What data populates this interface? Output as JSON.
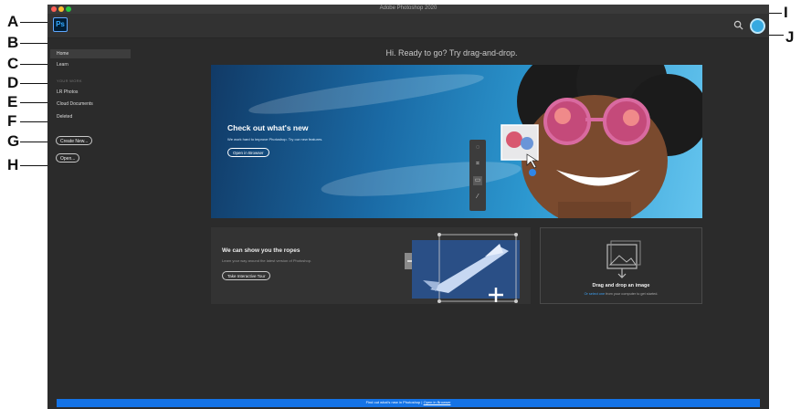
{
  "callouts": {
    "a": "A",
    "b": "B",
    "c": "C",
    "d": "D",
    "e": "E",
    "f": "F",
    "g": "G",
    "h": "H",
    "i": "I",
    "j": "J"
  },
  "window": {
    "title": "Adobe Photoshop 2020"
  },
  "topbar": {
    "app_logo": "Ps",
    "search_icon": "magnifier",
    "avatar_icon": "user-avatar"
  },
  "sidebar": {
    "home": "Home",
    "learn": "Learn",
    "section_heading": "YOUR WORK",
    "lr_photos": "LR Photos",
    "cloud_documents": "Cloud Documents",
    "deleted": "Deleted",
    "create_new": "Create New...",
    "open": "Open..."
  },
  "main": {
    "greeting": "Hi. Ready to go? Try drag-and-drop.",
    "hero": {
      "title": "Check out what's new",
      "subtitle": "We work hard to improve Photoshop. Try our new features.",
      "button": "Open in Browser"
    },
    "tour": {
      "title": "We can show you the ropes",
      "subtitle": "Learn your way around the latest version of Photoshop.",
      "button": "Take Interactive Tour"
    },
    "drop": {
      "title": "Drag and drop an image",
      "link": "Or select one",
      "subtitle_rest": "from your computer to get started."
    },
    "banner": {
      "text": "Find out what's new in Photoshop",
      "separator": "|",
      "link": "Open in Browser"
    }
  },
  "colors": {
    "accent": "#31a8ff",
    "banner": "#1473e6",
    "background": "#2b2b2b"
  }
}
